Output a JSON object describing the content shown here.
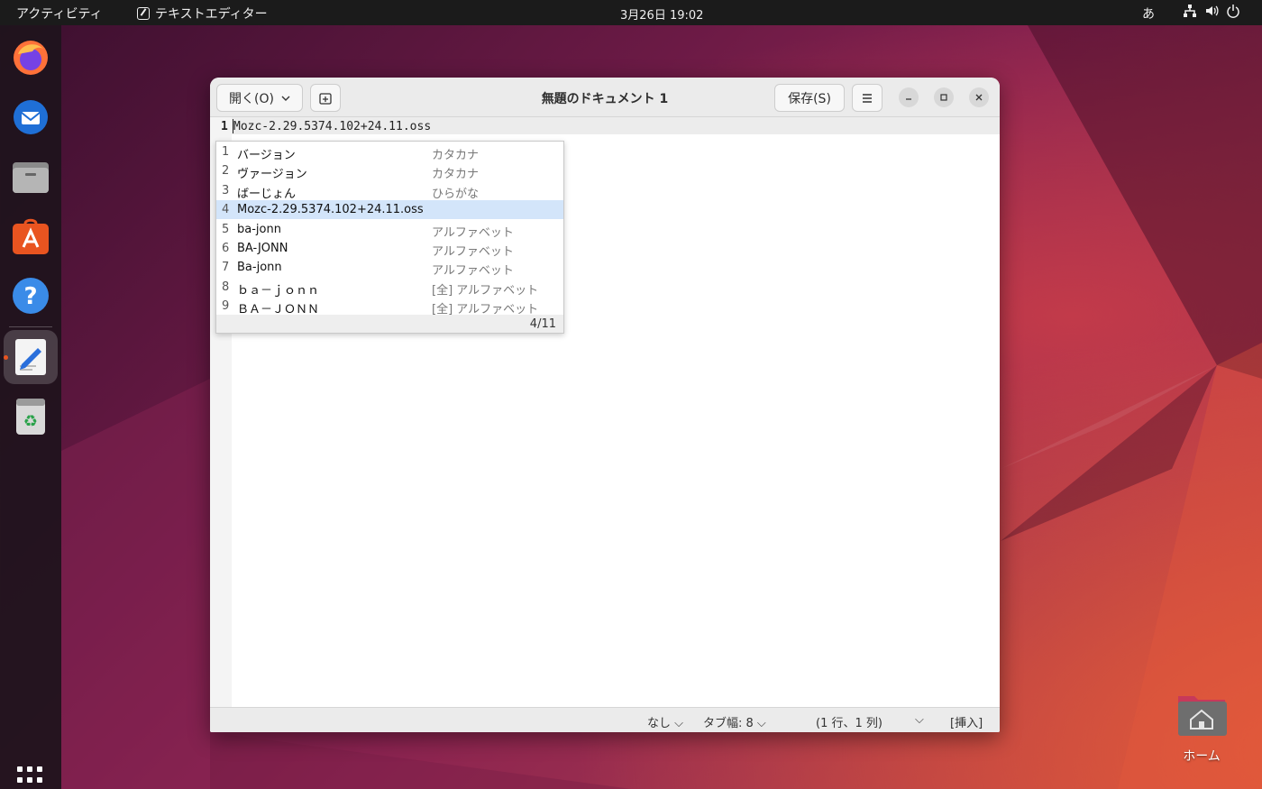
{
  "topbar": {
    "activities": "アクティビティ",
    "app_name": "テキストエディター",
    "clock": "3月26日  19:02",
    "ime": "あ"
  },
  "dock": {
    "items": [
      "firefox-icon",
      "thunderbird-icon",
      "files-icon",
      "app-center-icon",
      "help-icon",
      "text-editor-icon",
      "trash-icon"
    ]
  },
  "window": {
    "open_button": "開く(O)",
    "title": "無題のドキュメント 1",
    "save_button": "保存(S)",
    "line_number": "1",
    "line_text": "Mozc-2.29.5374.102+24.11.oss"
  },
  "candidates": {
    "items": [
      {
        "num": "1",
        "text": "バージョン",
        "desc": "カタカナ"
      },
      {
        "num": "2",
        "text": "ヴァージョン",
        "desc": "カタカナ"
      },
      {
        "num": "3",
        "text": "ばーじょん",
        "desc": "ひらがな"
      },
      {
        "num": "4",
        "text": "Mozc-2.29.5374.102+24.11.oss",
        "desc": ""
      },
      {
        "num": "5",
        "text": "ba-jonn",
        "desc": "アルファベット"
      },
      {
        "num": "6",
        "text": "BA-JONN",
        "desc": "アルファベット"
      },
      {
        "num": "7",
        "text": "Ba-jonn",
        "desc": "アルファベット"
      },
      {
        "num": "8",
        "text": "ｂａ－ｊｏｎｎ",
        "desc": "[全] アルファベット"
      },
      {
        "num": "9",
        "text": "ＢＡ－ＪＯＮＮ",
        "desc": "[全] アルファベット"
      }
    ],
    "selected_index": 3,
    "page": "4/11"
  },
  "statusbar": {
    "language": "なし",
    "tab_width": "タブ幅: 8",
    "position": "(1 行、1 列)",
    "mode": "[挿入]"
  },
  "desktop": {
    "home_label": "ホーム"
  },
  "colors": {
    "accent": "#e95420",
    "selection": "#d3e5fa"
  }
}
